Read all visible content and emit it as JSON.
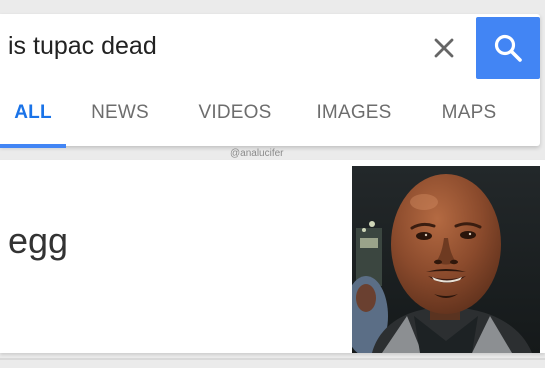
{
  "search": {
    "query": "is tupac dead",
    "clear_icon": "close-icon",
    "search_icon": "search-icon",
    "accent_color": "#4285f4"
  },
  "tabs": [
    {
      "label": "ALL",
      "active": true
    },
    {
      "label": "NEWS",
      "active": false
    },
    {
      "label": "VIDEOS",
      "active": false
    },
    {
      "label": "IMAGES",
      "active": false
    },
    {
      "label": "MAPS",
      "active": false
    }
  ],
  "watermark": "@analucifer",
  "result": {
    "answer": "egg",
    "image": "egg-face-photo"
  }
}
